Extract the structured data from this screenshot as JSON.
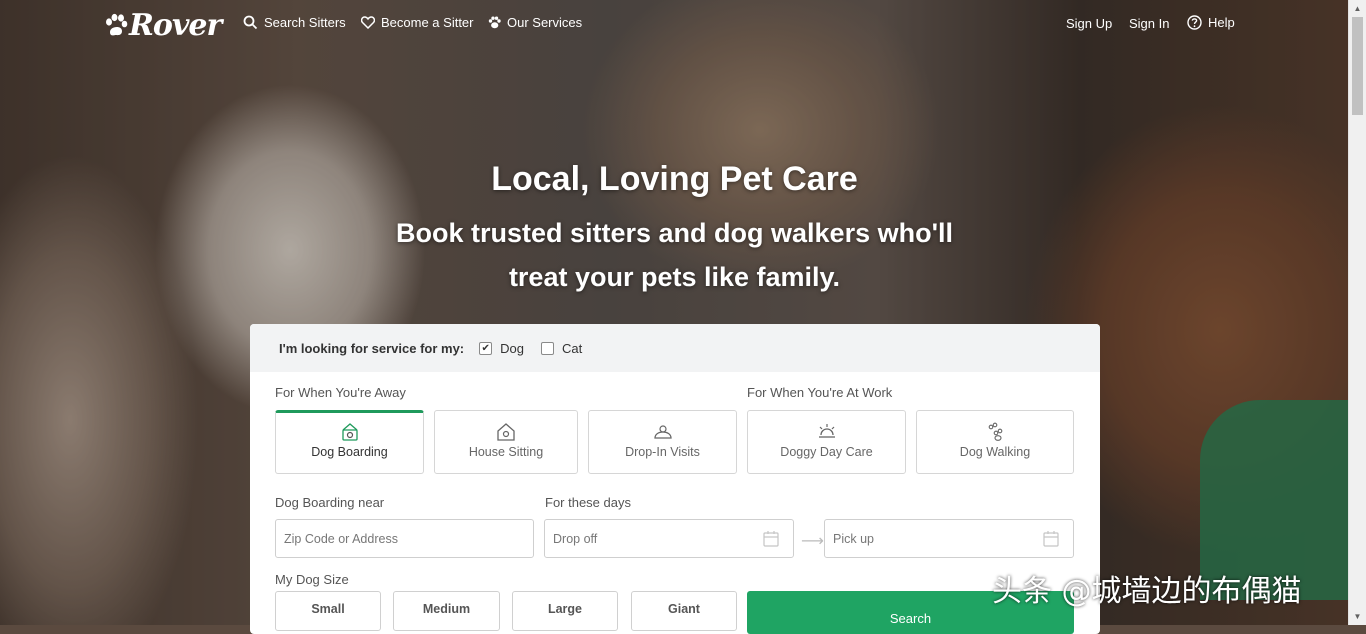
{
  "nav": {
    "brand": "Rover",
    "search_sitters": "Search Sitters",
    "become_sitter": "Become a Sitter",
    "our_services": "Our Services",
    "sign_up": "Sign Up",
    "sign_in": "Sign In",
    "help": "Help"
  },
  "hero": {
    "title": "Local, Loving Pet Care",
    "subtitle_line1": "Book trusted sitters and dog walkers who'll",
    "subtitle_line2": "treat your pets like family."
  },
  "form": {
    "looking_for_label": "I'm looking for service for my:",
    "pets": [
      {
        "label": "Dog",
        "checked": true
      },
      {
        "label": "Cat",
        "checked": false
      }
    ],
    "away_label": "For When You're Away",
    "work_label": "For When You're At Work",
    "services": [
      {
        "label": "Dog Boarding",
        "icon": "dog-boarding-icon",
        "selected": true
      },
      {
        "label": "House Sitting",
        "icon": "house-sitting-icon",
        "selected": false
      },
      {
        "label": "Drop-In Visits",
        "icon": "drop-in-visits-icon",
        "selected": false
      },
      {
        "label": "Doggy Day Care",
        "icon": "doggy-day-care-icon",
        "selected": false
      },
      {
        "label": "Dog Walking",
        "icon": "dog-walking-icon",
        "selected": false
      }
    ],
    "location_label": "Dog Boarding near",
    "location_placeholder": "Zip Code or Address",
    "dates_label": "For these days",
    "dropoff_placeholder": "Drop off",
    "pickup_placeholder": "Pick up",
    "dog_size_label": "My Dog Size",
    "sizes": [
      "Small",
      "Medium",
      "Large",
      "Giant"
    ],
    "search_label": "Search"
  },
  "watermark": "头条 @城墙边的布偶猫",
  "colors": {
    "accent": "#1fa463",
    "active_border": "#1f9a5c"
  }
}
